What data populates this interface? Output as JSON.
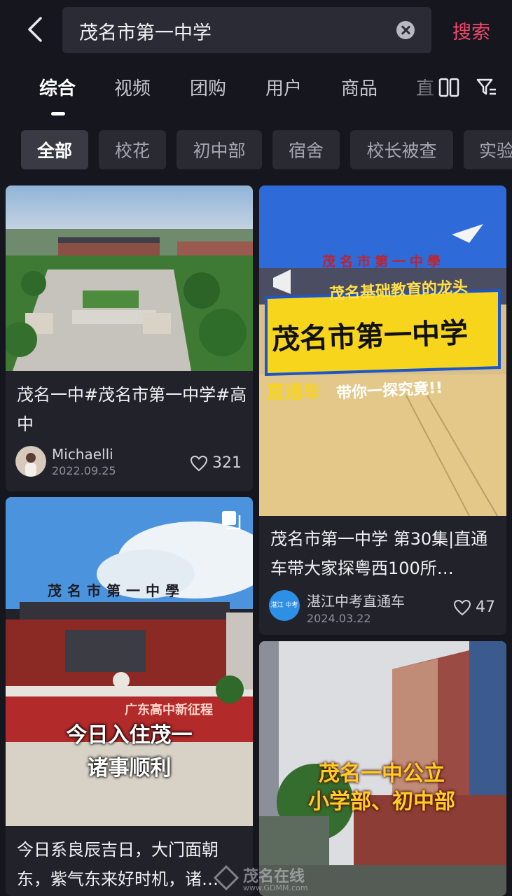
{
  "search": {
    "query": "茂名市第一中学",
    "button": "搜索"
  },
  "tabs": [
    "综合",
    "视频",
    "团购",
    "用户",
    "商品",
    "直"
  ],
  "chips": [
    "全部",
    "校花",
    "初中部",
    "宿舍",
    "校长被查",
    "实验"
  ],
  "cards": [
    {
      "title": "茂名一中#茂名市第一中学#高中",
      "author": "Michaelli",
      "date": "2022.09.25",
      "likes": "321"
    },
    {
      "title": "茂名市第一中学 第30集|直通车带大家探粤西100所…",
      "author": "湛江中考直通车",
      "date": "2024.03.22",
      "likes": "47",
      "overlay": {
        "tag": "茂名基础教育的龙头",
        "main": "茂名市第一中学",
        "sub1": "直通车",
        "sub2": "带你一探究竟!!",
        "sign": "茂名市第一中學"
      },
      "avatar_text": "湛江 中考"
    },
    {
      "title": "今日系良辰吉日，大门面朝东，紫气东来好时机，诸…",
      "overlay": {
        "line1": "今日入住茂一",
        "line2": "诸事顺利",
        "sign": "茂名市第一中學",
        "banner": "广东高中新征程"
      }
    },
    {
      "overlay": {
        "line1": "茂名一中公立",
        "line2": "小学部、初中部"
      }
    }
  ],
  "watermark": {
    "name": "茂名在线",
    "url": "www.GDMM.com"
  },
  "colors": {
    "accent": "#f0486b",
    "background": "#16161e",
    "card": "#22222b"
  }
}
